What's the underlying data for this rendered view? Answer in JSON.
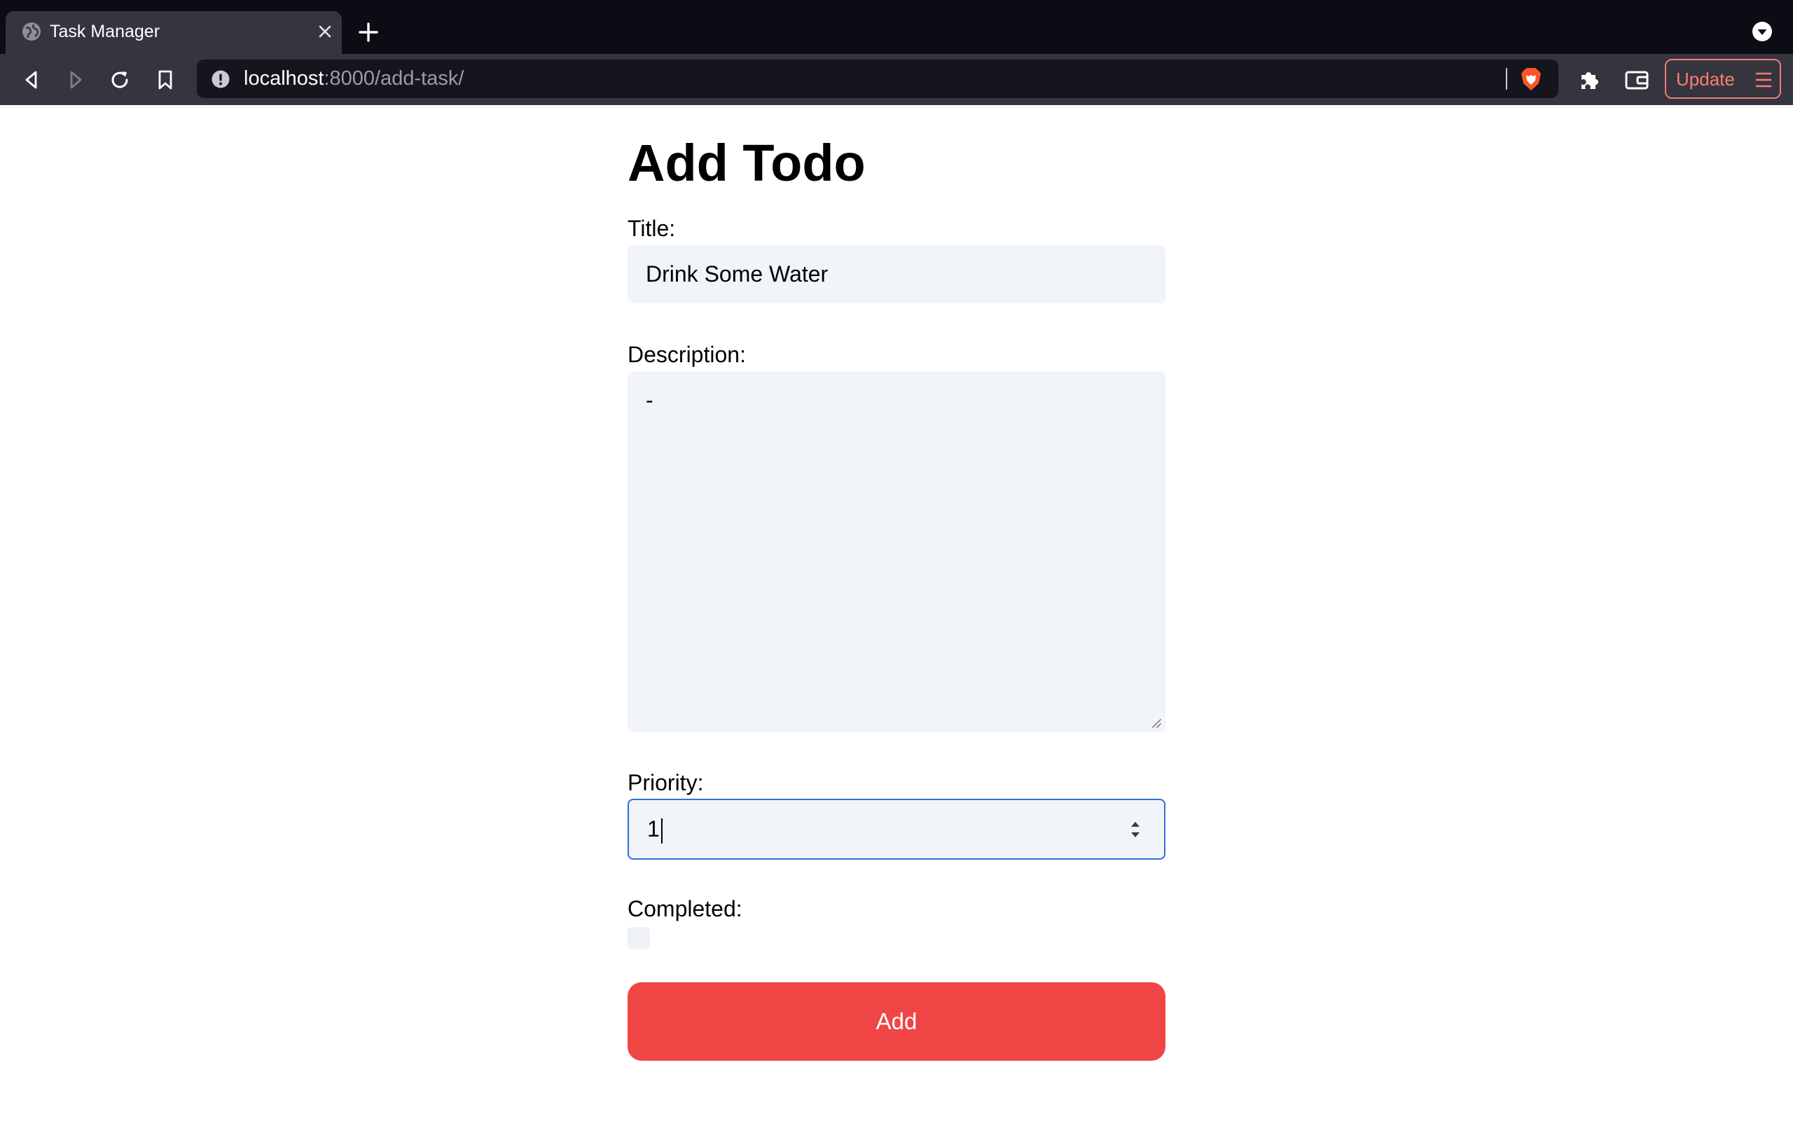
{
  "browser": {
    "tab": {
      "title": "Task Manager"
    },
    "address": {
      "host": "localhost",
      "path": ":8000/add-task/"
    },
    "update_label": "Update",
    "icons": {
      "favicon": "globe-icon",
      "tab_close": "close-icon",
      "new_tab": "plus-icon",
      "tab_menu": "chevron-down-circle-icon",
      "back": "back-arrow-icon",
      "forward": "forward-arrow-icon",
      "reload": "reload-icon",
      "bookmark": "bookmark-icon",
      "site_info": "info-icon",
      "shield": "brave-lion-icon",
      "extensions": "puzzle-icon",
      "wallet": "wallet-icon",
      "menu": "hamburger-menu-icon"
    },
    "colors": {
      "update_accent": "#ff7c70",
      "brave_orange": "#fb542b"
    }
  },
  "page": {
    "heading": "Add Todo",
    "form": {
      "title_label": "Title:",
      "title_value": "Drink Some Water",
      "description_label": "Description:",
      "description_value": "-",
      "priority_label": "Priority:",
      "priority_value": "1",
      "completed_label": "Completed:",
      "completed_checked": false,
      "submit_label": "Add"
    },
    "colors": {
      "input_bg": "#f1f4f9",
      "focus_border": "#2f6fde",
      "button_bg": "#f04545"
    }
  }
}
